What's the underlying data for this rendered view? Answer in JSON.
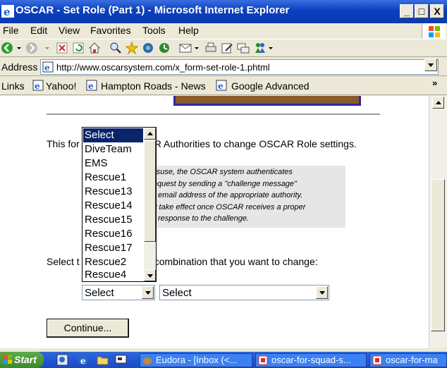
{
  "window": {
    "title": "OSCAR - Set Role (Part 1) - Microsoft Internet Explorer",
    "controls": [
      "_",
      "□",
      "X"
    ]
  },
  "menu": [
    "File",
    "Edit",
    "View",
    "Favorites",
    "Tools",
    "Help"
  ],
  "address": {
    "label": "Address",
    "url": "http://www.oscarsystem.com/x_form-set-role-1.phtml"
  },
  "links": {
    "label": "Links",
    "items": [
      "Yahoo!",
      "Hampton Roads - News",
      "Google Advanced"
    ],
    "more": "»"
  },
  "page": {
    "intro_left": "This for",
    "intro_right": "R Authorities to change OSCAR Role settings.",
    "note_lines": [
      "t misuse, the OSCAR system authenticates",
      "n request by sending a \"challenge message\"",
      "email address of the appropriate authority.",
      "y take effect once OSCAR receives a proper",
      "response to the challenge."
    ],
    "prompt_left": "Select t",
    "prompt_right": "combination that you want to change:",
    "select1_value": "Select",
    "select2_value": "Select",
    "continue_label": "Continue..."
  },
  "dropdown": {
    "options": [
      "Select",
      "DiveTeam",
      "EMS",
      "Rescue1",
      "Rescue13",
      "Rescue14",
      "Rescue15",
      "Rescue16",
      "Rescue17",
      "Rescue2",
      "Rescue4"
    ],
    "selected_index": 0
  },
  "taskbar": {
    "start_label": "Start",
    "tasks": [
      "Eudora - [Inbox (<...",
      "oscar-for-squad-s...",
      "oscar-for-ma"
    ]
  },
  "colors": {
    "titlebar": "#0a3fbf",
    "selection": "#0a246a",
    "taskbar": "#245ad8"
  }
}
